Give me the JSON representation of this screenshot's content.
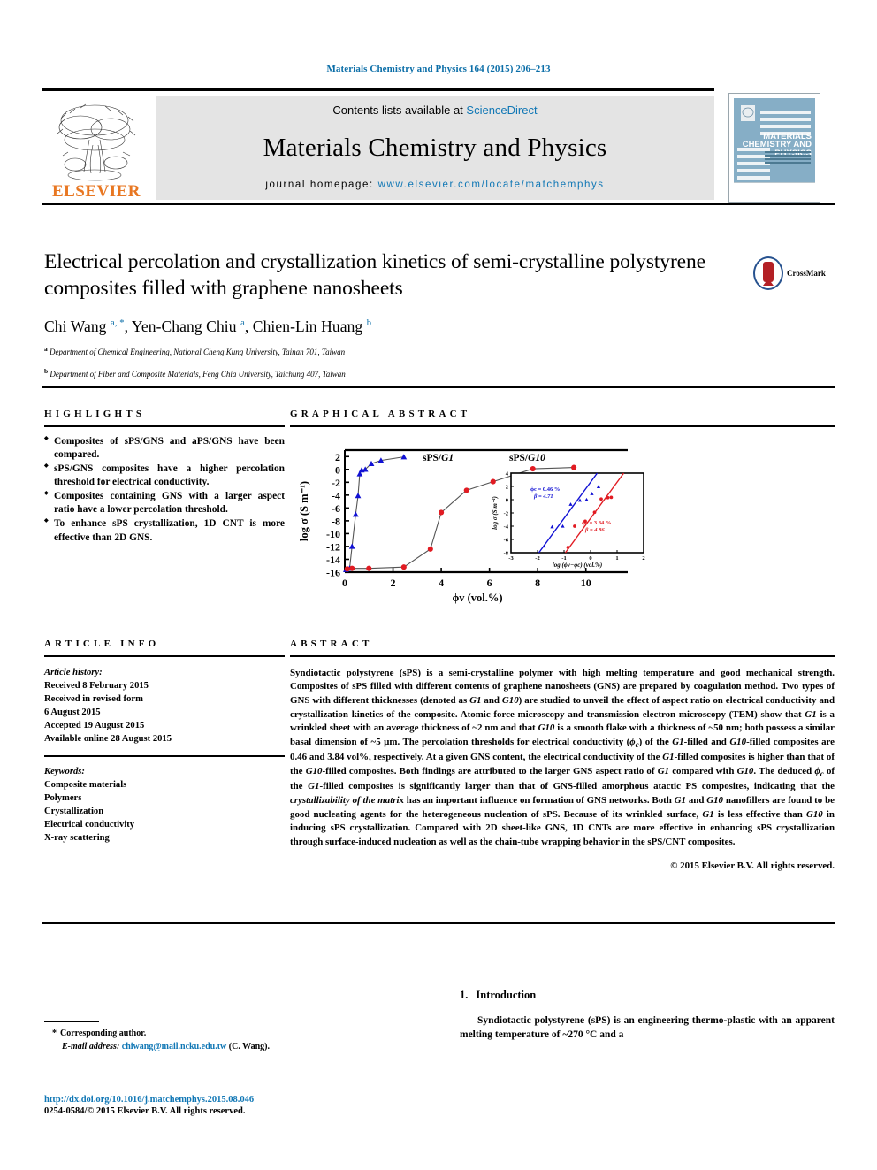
{
  "citation": "Materials Chemistry and Physics 164 (2015) 206–213",
  "masthead": {
    "contents_prefix": "Contents lists available at ",
    "sciencedirect": "ScienceDirect",
    "journal_title": "Materials Chemistry and Physics",
    "homepage_prefix": "journal homepage: ",
    "homepage_url": "www.elsevier.com/locate/matchemphys",
    "elsevier_word": "ELSEVIER",
    "cover_title_line1": "MATERIALS",
    "cover_title_line2": "CHEMISTRY AND",
    "cover_title_line3": "PHYSICS"
  },
  "title": "Electrical percolation and crystallization kinetics of semi-crystalline polystyrene composites filled with graphene nanosheets",
  "authors_html": "Chi Wang <sup>a, *</sup>, Yen-Chang Chiu <sup>a</sup>, Chien-Lin Huang <sup>b</sup>",
  "affiliations": [
    "Department of Chemical Engineering, National Cheng Kung University, Tainan 701, Taiwan",
    "Department of Fiber and Composite Materials, Feng Chia University, Taichung 407, Taiwan"
  ],
  "crossmark_label": "CrossMark",
  "highlights": {
    "heading": "HIGHLIGHTS",
    "items": [
      "Composites of sPS/GNS and aPS/GNS have been compared.",
      "sPS/GNS composites have a higher percolation threshold for electrical conductivity.",
      "Composites containing GNS with a larger aspect ratio have a lower percolation threshold.",
      "To enhance sPS crystallization, 1D CNT is more effective than 2D GNS."
    ]
  },
  "graphical_abstract": {
    "heading": "GRAPHICAL ABSTRACT"
  },
  "chart_data": {
    "type": "line",
    "title": "",
    "xlabel": "ϕv (vol.%)",
    "ylabel": "log σ (S m⁻¹)",
    "xlim": [
      0,
      11
    ],
    "ylim": [
      -16,
      3
    ],
    "xticks": [
      0,
      2,
      4,
      6,
      8,
      10
    ],
    "yticks": [
      2,
      0,
      -2,
      -4,
      -6,
      -8,
      -10,
      -12,
      -14,
      -16
    ],
    "grid": false,
    "legend_position": "in-plot",
    "series": [
      {
        "name": "sPS/G1",
        "color": "#1111d4",
        "marker": "triangle",
        "x": [
          0.05,
          0.2,
          0.3,
          0.45,
          0.55,
          0.62,
          0.7,
          0.85,
          1.1,
          1.5,
          2.45
        ],
        "y": [
          -15.6,
          -15.4,
          -12.0,
          -7.0,
          -4.1,
          -0.7,
          -0.1,
          0.0,
          0.9,
          1.4,
          1.95
        ]
      },
      {
        "name": "sPS/G10",
        "color": "#e11b22",
        "marker": "circle",
        "x": [
          0.1,
          0.3,
          1.0,
          2.45,
          3.55,
          4.0,
          5.05,
          6.15,
          7.8,
          9.5
        ],
        "y": [
          -15.5,
          -15.4,
          -15.4,
          -15.2,
          -12.4,
          -6.7,
          -3.25,
          -1.9,
          0.1,
          0.3
        ]
      }
    ],
    "inset": {
      "type": "scatter",
      "xlabel": "log (ϕv−ϕc) (vol.%)",
      "ylabel": "log σ (S m⁻¹)",
      "xlim": [
        -3,
        2
      ],
      "ylim": [
        -8,
        4
      ],
      "xticks": [
        -3,
        -2,
        -1,
        0,
        1,
        2
      ],
      "yticks": [
        4,
        2,
        0,
        -2,
        -4,
        -6,
        -8
      ],
      "annotations": [
        {
          "text_phi": "ϕc = 0.46 %",
          "text_beta": "β = 4.71",
          "color": "#1111d4"
        },
        {
          "text_phi": "ϕc = 3.84 %",
          "text_beta": "β = 4.86",
          "color": "#e11b22"
        }
      ],
      "series": [
        {
          "name": "G1",
          "color": "#1111d4",
          "marker": "triangle",
          "x": [
            -1.75,
            -1.45,
            -1.05,
            -0.75,
            -0.4,
            -0.15,
            0.05,
            0.3
          ],
          "y": [
            -7.0,
            -4.1,
            -4.0,
            -0.7,
            -0.1,
            0.0,
            0.9,
            1.95
          ]
        },
        {
          "name": "G10",
          "color": "#e11b22",
          "marker": "circle",
          "x": [
            -0.85,
            -0.6,
            -0.2,
            0.15,
            0.4,
            0.65,
            0.78
          ],
          "y": [
            -7.2,
            -4.0,
            -3.25,
            -1.9,
            0.1,
            0.3,
            0.35
          ]
        }
      ],
      "fit_lines": [
        {
          "color": "#1111d4",
          "x0": -1.95,
          "y0": -8.0,
          "x1": 0.25,
          "y1": 4.0
        },
        {
          "color": "#e11b22",
          "x0": -0.95,
          "y0": -8.0,
          "x1": 1.25,
          "y1": 4.0
        }
      ]
    }
  },
  "article_info": {
    "heading": "ARTICLE INFO",
    "history_label": "Article history:",
    "history": [
      "Received 8 February 2015",
      "Received in revised form",
      "6 August 2015",
      "Accepted 19 August 2015",
      "Available online 28 August 2015"
    ],
    "keywords_label": "Keywords:",
    "keywords": [
      "Composite materials",
      "Polymers",
      "Crystallization",
      "Electrical conductivity",
      "X-ray scattering"
    ]
  },
  "abstract": {
    "heading": "ABSTRACT",
    "paragraph_html": "Syndiotactic polystyrene (sPS) is a semi-crystalline polymer with high melting temperature and good mechanical strength. Composites of sPS filled with different contents of graphene nanosheets (GNS) are prepared by coagulation method. Two types of GNS with different thicknesses (denoted as <span class=\"it\">G1</span> and <span class=\"it\">G10</span>) are studied to unveil the effect of aspect ratio on electrical conductivity and crystallization kinetics of the composite. Atomic force microscopy and transmission electron microscopy (TEM) show that <span class=\"it\">G1</span> is a wrinkled sheet with an average thickness of ~2 nm and that <span class=\"it\">G10</span> is a smooth flake with a thickness of ~50 nm; both possess a similar basal dimension of ~5 µm. The percolation thresholds for electrical conductivity (<span class=\"it\">ϕ</span><sub class=\"it\">c</sub>) of the <span class=\"it\">G1</span>-filled and <span class=\"it\">G10</span>-filled composites are 0.46 and 3.84 vol%, respectively. At a given GNS content, the electrical conductivity of the <span class=\"it\">G1</span>-filled composites is higher than that of the <span class=\"it\">G10</span>-filled composites. Both findings are attributed to the larger GNS aspect ratio of <span class=\"it\">G1</span> compared with <span class=\"it\">G10</span>. The deduced <span class=\"it\">ϕ</span><sub class=\"it\">c</sub> of the <span class=\"it\">G1</span>-filled composites is significantly larger than that of GNS-filled amorphous atactic PS composites, indicating that the <span class=\"it\">crystallizability of the matrix</span> has an important influence on formation of GNS networks. Both <span class=\"it\">G1</span> and <span class=\"it\">G10</span> nanofillers are found to be good nucleating agents for the heterogeneous nucleation of sPS. Because of its wrinkled surface, <span class=\"it\">G1</span> is less effective than <span class=\"it\">G10</span> in inducing sPS crystallization. Compared with 2D sheet-like GNS, 1D CNTs are more effective in enhancing sPS crystallization through surface-induced nucleation as well as the chain-tube wrapping behavior in the sPS/CNT composites.",
    "copyright": "© 2015 Elsevier B.V. All rights reserved."
  },
  "introduction": {
    "number": "1.",
    "heading": "Introduction",
    "paragraph": "Syndiotactic polystyrene (sPS) is an engineering thermo-plastic with an apparent melting temperature of ~270 °C and a"
  },
  "corresponding": {
    "star": "*",
    "label": "Corresponding author.",
    "email_label": "E-mail address:",
    "email": "chiwang@mail.ncku.edu.tw",
    "email_suffix": "(C. Wang)."
  },
  "footer": {
    "doi": "http://dx.doi.org/10.1016/j.matchemphys.2015.08.046",
    "issn": "0254-0584/© 2015 Elsevier B.V. All rights reserved."
  },
  "colors": {
    "link": "#1077b5",
    "elsevier_orange": "#E87722",
    "series_g1": "#1111d4",
    "series_g10": "#e11b22"
  }
}
